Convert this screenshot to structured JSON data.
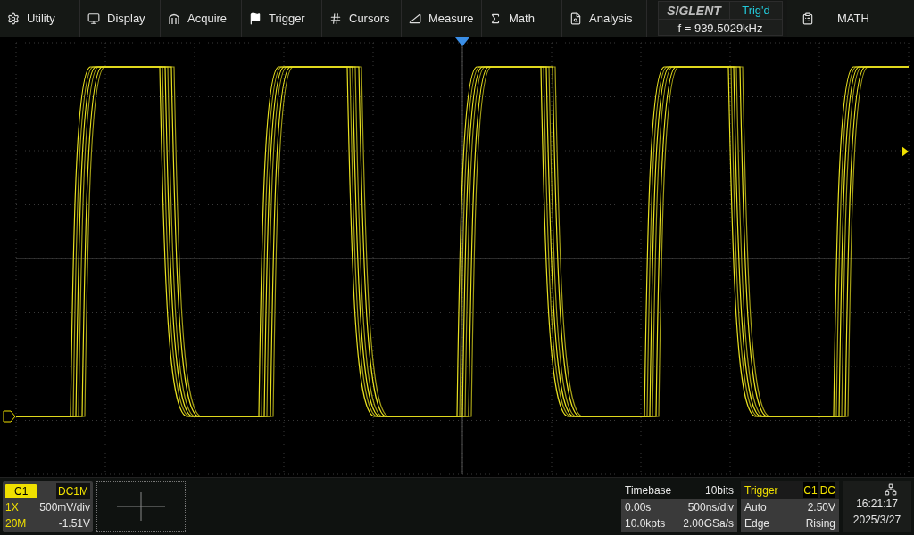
{
  "menu": [
    {
      "label": "Utility"
    },
    {
      "label": "Display"
    },
    {
      "label": "Acquire"
    },
    {
      "label": "Trigger"
    },
    {
      "label": "Cursors"
    },
    {
      "label": "Measure"
    },
    {
      "label": "Math"
    },
    {
      "label": "Analysis"
    }
  ],
  "status": {
    "brand": "SIGLENT",
    "trigger_state": "Trig'd",
    "frequency": "f = 939.5029kHz"
  },
  "math_button": {
    "label": "MATH"
  },
  "channel": {
    "name": "C1",
    "coupling": "DC1M",
    "probe": "1X",
    "scale": "500mV/div",
    "bandwidth": "20M",
    "offset": "-1.51V"
  },
  "timebase": {
    "title": "Timebase",
    "bits": "10bits",
    "delay": "0.00s",
    "scale": "500ns/div",
    "memory": "10.0kpts",
    "sample_rate": "2.00GSa/s"
  },
  "trigger": {
    "title": "Trigger",
    "source": "C1",
    "coupling": "DC",
    "mode": "Auto",
    "level": "2.50V",
    "type": "Edge",
    "slope": "Rising"
  },
  "clock": {
    "time": "16:21:17",
    "date": "2025/3/27"
  }
}
